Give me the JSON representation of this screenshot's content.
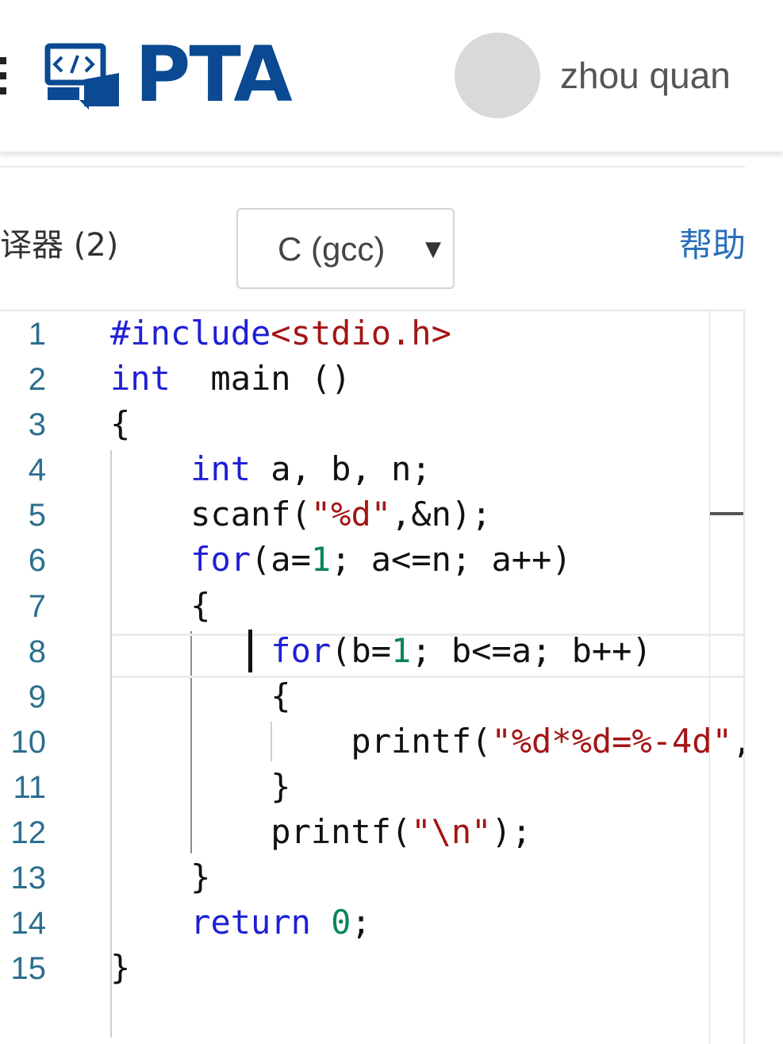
{
  "header": {
    "logo_text": "PTA",
    "logo_icon": "code-bracket-icon",
    "username": "zhou quan",
    "brand_color": "#0b4a92"
  },
  "toolbar": {
    "compiler_label": "译器 (2)",
    "language_selected": "C (gcc)",
    "help_label": "帮助"
  },
  "editor": {
    "line_numbers": [
      "1",
      "2",
      "3",
      "4",
      "5",
      "6",
      "7",
      "8",
      "9",
      "10",
      "11",
      "12",
      "13",
      "14",
      "15"
    ],
    "active_line": 8,
    "lines": [
      [
        [
          "kw",
          "#include"
        ],
        [
          "str",
          "<stdio.h>"
        ]
      ],
      [
        [
          "kw",
          "int"
        ],
        [
          "",
          "  main ()"
        ]
      ],
      [
        [
          "",
          "{"
        ]
      ],
      [
        [
          "",
          "    "
        ],
        [
          "kw",
          "int"
        ],
        [
          "",
          " a, b, n;"
        ]
      ],
      [
        [
          "",
          "    scanf("
        ],
        [
          "str",
          "\"%d\""
        ],
        [
          "",
          ",&n);"
        ]
      ],
      [
        [
          "",
          "    "
        ],
        [
          "kw",
          "for"
        ],
        [
          "",
          "(a="
        ],
        [
          "num",
          "1"
        ],
        [
          "",
          "; a<=n; a++)"
        ]
      ],
      [
        [
          "",
          "    {"
        ]
      ],
      [
        [
          "",
          "        "
        ],
        [
          "kw",
          "for"
        ],
        [
          "",
          "(b="
        ],
        [
          "num",
          "1"
        ],
        [
          "",
          "; b<=a; b++)"
        ]
      ],
      [
        [
          "",
          "        {"
        ]
      ],
      [
        [
          "",
          "            printf("
        ],
        [
          "str",
          "\"%d*%d=%-4d\""
        ],
        [
          "",
          ","
        ]
      ],
      [
        [
          "",
          "        }"
        ]
      ],
      [
        [
          "",
          "        printf("
        ],
        [
          "str",
          "\"\\n\""
        ],
        [
          "",
          ");"
        ]
      ],
      [
        [
          "",
          "    }"
        ]
      ],
      [
        [
          "",
          "    "
        ],
        [
          "kw",
          "return"
        ],
        [
          "",
          " "
        ],
        [
          "num",
          "0"
        ],
        [
          "",
          ";"
        ]
      ],
      [
        [
          "",
          "}"
        ]
      ]
    ]
  }
}
